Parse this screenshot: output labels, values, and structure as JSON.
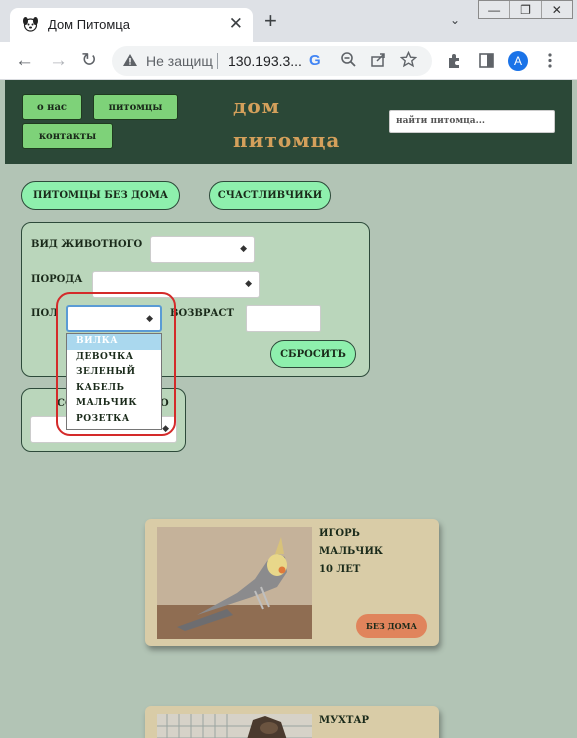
{
  "browser": {
    "tab_title": "Дом Питомца",
    "tab_close": "✕",
    "new_tab": "+",
    "tab_search": "⌄",
    "window_controls": [
      "—",
      "❐",
      "✕"
    ],
    "back": "←",
    "forward": "→",
    "reload": "↻",
    "security_icon": "warning-triangle-icon",
    "security_text": "Не защищ",
    "url": "130.193.3...",
    "google_letter": "G",
    "profile_initial": "A"
  },
  "header": {
    "nav": [
      "о нас",
      "питомцы",
      "контакты"
    ],
    "logo_line1": "дом",
    "logo_line2": "питомца",
    "search_placeholder": "найти питомца..."
  },
  "filters": {
    "homeless_button": "ПИТОМЦЫ БЕЗ ДОМА",
    "lucky_button": "СЧАСТЛИВЧИКИ",
    "species_label": "ВИД ЖИВОТНОГО",
    "breed_label": "ПОРОДА",
    "gender_label": "ПОЛ",
    "age_label": "ВОЗВРАСТ",
    "reset_button": "СБРОСИТЬ",
    "sort_label_partial": "СО",
    "sort_label_tail": "О"
  },
  "gender_dropdown": {
    "options": [
      "ВИЛКА",
      "ДЕВОЧКА",
      "ЗЕЛЕНЫЙ",
      "КАБЕЛЬ",
      "МАЛЬЧИК",
      "РОЗЕТКА"
    ],
    "selected_index": 0
  },
  "pets": [
    {
      "name": "ИГОРЬ",
      "gender": "МАЛЬЧИК",
      "age": "10 ЛЕТ",
      "status": "БЕЗ ДОМА"
    },
    {
      "name": "МУХТАР"
    }
  ],
  "colors": {
    "page_bg": "#b2c4b5",
    "header_bg": "#2b4837",
    "logo": "#d4a05b",
    "pill_green": "#8ef0ad",
    "card_bg": "#d9cca7",
    "status_orange": "#e0845c",
    "annotation_red": "#d42a2a"
  }
}
